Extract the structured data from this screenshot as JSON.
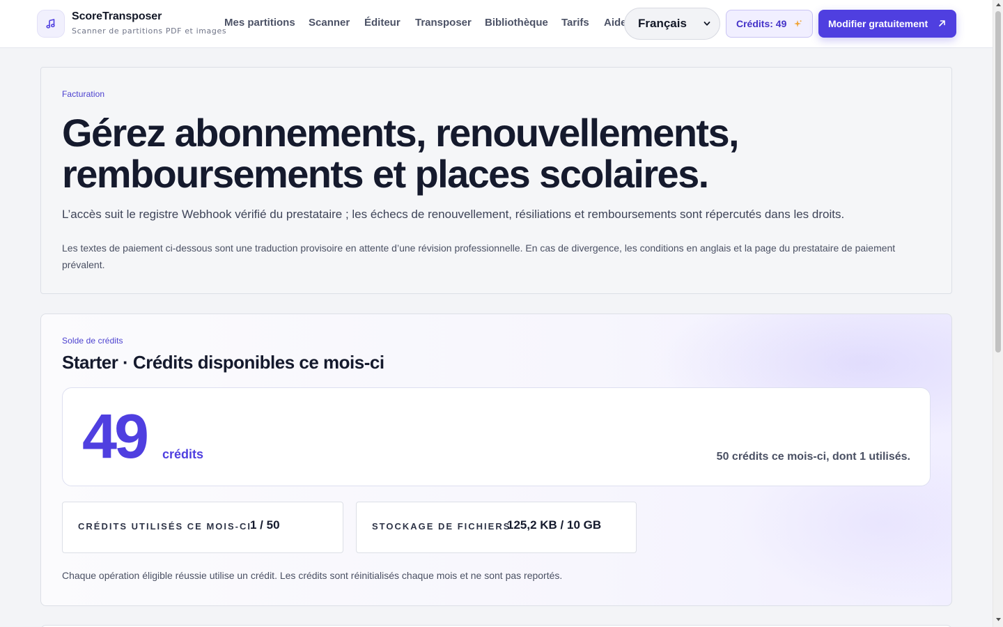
{
  "brand": {
    "name": "ScoreTransposer",
    "tagline": "Scanner de partitions PDF et images",
    "logo_icon": "music-note-icon"
  },
  "nav": {
    "links": [
      "Mes partitions",
      "Scanner",
      "Éditeur",
      "Transposer",
      "Bibliothèque",
      "Tarifs",
      "Aide"
    ]
  },
  "header": {
    "language_selected": "Français",
    "credits_label": "Crédits: 49",
    "cta_label": "Modifier gratuitement",
    "cta_icon": "arrow-up-right-icon",
    "credits_icon": "sparkle-icon",
    "accent_color": "#4f3fe0"
  },
  "billing": {
    "eyebrow": "Facturation",
    "title_line1": "Gérez abonnements, renouvellements,",
    "title_line2": "remboursements et places scolaires.",
    "subtitle": "L’accès suit le registre Webhook vérifié du prestataire ; les échecs de renouvellement, résiliations et remboursements sont répercutés dans les droits.",
    "note": "Les textes de paiement ci-dessous sont une traduction provisoire en attente d’une révision professionnelle. En cas de divergence, les conditions en anglais et la page du prestataire de paiement prévalent."
  },
  "credits": {
    "eyebrow": "Solde de crédits",
    "title": "Starter · Crédits disponibles ce mois-ci",
    "balance": "49",
    "balance_unit": "crédits",
    "summary": "50 crédits ce mois-ci, dont 1 utilisés.",
    "stats": [
      {
        "label": "CRÉDITS UTILISÉS CE MOIS-CI",
        "value": "1 / 50"
      },
      {
        "label": "STOCKAGE DE FICHIERS",
        "value": "125,2 KB / 10 GB"
      }
    ],
    "footnote": "Chaque opération éligible réussie utilise un crédit. Les crédits sont réinitialisés chaque mois et ne sont pas reportés."
  }
}
